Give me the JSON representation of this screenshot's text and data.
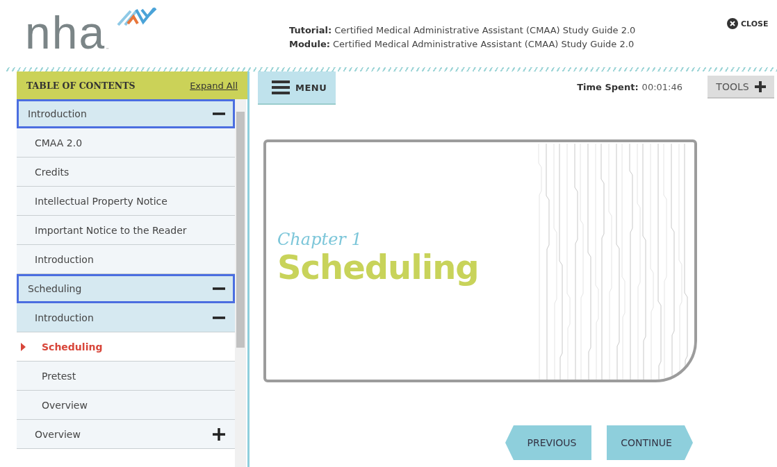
{
  "header": {
    "logo_text": "nha",
    "logo_mark": "™",
    "info": [
      {
        "label": "Tutorial:",
        "value": "Certified Medical Administrative Assistant (CMAA) Study Guide 2.0"
      },
      {
        "label": "Module:",
        "value": "Certified Medical Administrative Assistant (CMAA) Study Guide 2.0"
      }
    ],
    "close": "CLOSE"
  },
  "toc": {
    "title": "TABLE OF CONTENTS",
    "expand_all": "Expand All",
    "items": [
      {
        "label": "Introduction",
        "expanded": true,
        "focused": true,
        "selected": false,
        "children": [
          {
            "label": "CMAA 2.0",
            "selected": false
          },
          {
            "label": "Credits",
            "selected": false
          },
          {
            "label": "Intellectual Property Notice",
            "selected": false
          },
          {
            "label": "Important Notice to the Reader",
            "selected": false
          },
          {
            "label": "Introduction",
            "selected": false
          }
        ]
      },
      {
        "label": "Scheduling",
        "expanded": true,
        "focused": true,
        "selected": false,
        "children": [
          {
            "label": "Introduction",
            "expanded": true,
            "selected": false,
            "children": [
              {
                "label": "Scheduling",
                "selected": true
              },
              {
                "label": "Pretest",
                "selected": false
              },
              {
                "label": "Overview",
                "selected": false
              }
            ]
          },
          {
            "label": "Overview",
            "expanded": false,
            "selected": false
          }
        ]
      }
    ]
  },
  "toolbar": {
    "menu": "MENU",
    "time_label": "Time Spent:",
    "time_value": "00:01:46",
    "tools": "TOOLS"
  },
  "slide": {
    "chapter": "Chapter 1",
    "title": "Scheduling"
  },
  "nav": {
    "previous": "PREVIOUS",
    "continue": "CONTINUE"
  }
}
